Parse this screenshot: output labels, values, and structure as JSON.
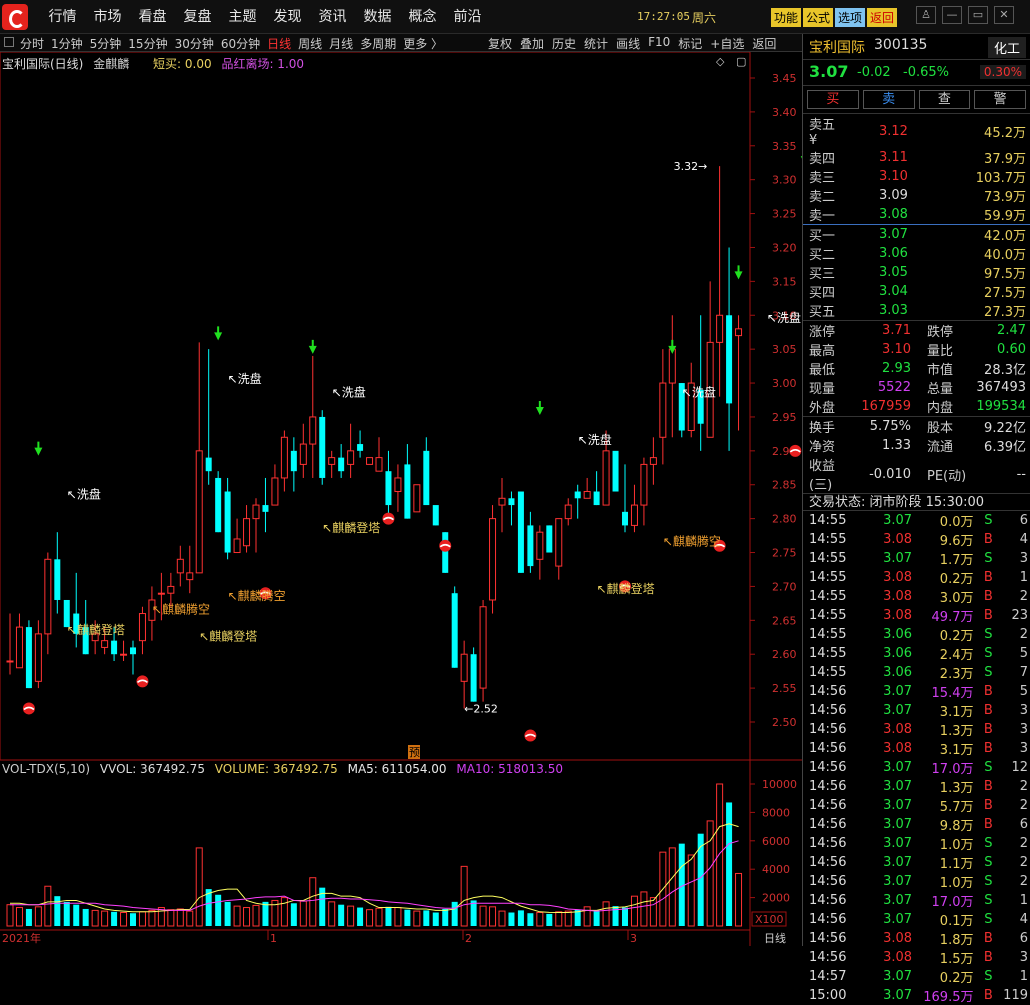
{
  "menu": [
    "行情",
    "市场",
    "看盘",
    "复盘",
    "主题",
    "发现",
    "资讯",
    "数据",
    "概念",
    "前沿"
  ],
  "clock": "17:27:05",
  "weekday": "周六",
  "func_buttons": [
    "功能",
    "公式",
    "选项",
    "返回"
  ],
  "window_buttons": [
    "shirt-icon",
    "minimize-icon",
    "restore-icon",
    "close-icon"
  ],
  "periods": [
    "分时",
    "1分钟",
    "5分钟",
    "15分钟",
    "30分钟",
    "60分钟",
    "日线",
    "周线",
    "月线",
    "多周期",
    "更多 〉"
  ],
  "active_period": "日线",
  "tools": [
    "复权",
    "叠加",
    "历史",
    "统计",
    "画线",
    "F10",
    "标记",
    "+自选",
    "返回"
  ],
  "chart_header": {
    "stock": "宝利国际(日线)",
    "indicator": "金麒麟",
    "short_buy": "短买: 0.00",
    "exit": "品红离场: 1.00"
  },
  "volume_header": {
    "name": "VOL-TDX(5,10)",
    "vvol": "VVOL: 367492.75",
    "volume": "VOLUME: 367492.75",
    "ma5": "MA5: 611054.00",
    "ma10": "MA10: 518013.50"
  },
  "chart_data": {
    "type": "candlestick",
    "price_ticks": [
      3.45,
      3.4,
      3.35,
      3.3,
      3.25,
      3.2,
      3.15,
      3.1,
      3.05,
      3.0,
      2.95,
      2.9,
      2.85,
      2.8,
      2.75,
      2.7,
      2.65,
      2.6,
      2.55,
      2.5
    ],
    "vol_ticks": [
      10000,
      8000,
      6000,
      4000,
      2000
    ],
    "vol_unit": "X100",
    "x_labels": [
      "2021年",
      "1",
      "2",
      "3",
      "日线"
    ],
    "candles": [
      [
        2.59,
        2.66,
        2.57,
        2.59
      ],
      [
        2.58,
        2.66,
        2.58,
        2.64
      ],
      [
        2.64,
        2.65,
        2.55,
        2.55
      ],
      [
        2.56,
        2.65,
        2.55,
        2.63
      ],
      [
        2.63,
        2.75,
        2.6,
        2.74
      ],
      [
        2.74,
        2.78,
        2.66,
        2.68
      ],
      [
        2.68,
        2.68,
        2.64,
        2.64
      ],
      [
        2.66,
        2.72,
        2.61,
        2.63
      ],
      [
        2.64,
        2.68,
        2.6,
        2.6
      ],
      [
        2.62,
        2.65,
        2.6,
        2.63
      ],
      [
        2.61,
        2.64,
        2.6,
        2.62
      ],
      [
        2.62,
        2.64,
        2.59,
        2.6
      ],
      [
        2.6,
        2.62,
        2.59,
        2.6
      ],
      [
        2.61,
        2.62,
        2.57,
        2.6
      ],
      [
        2.62,
        2.67,
        2.6,
        2.66
      ],
      [
        2.65,
        2.7,
        2.62,
        2.68
      ],
      [
        2.69,
        2.72,
        2.65,
        2.69
      ],
      [
        2.69,
        2.72,
        2.67,
        2.7
      ],
      [
        2.72,
        2.76,
        2.7,
        2.74
      ],
      [
        2.71,
        2.76,
        2.69,
        2.72
      ],
      [
        2.72,
        3.06,
        2.73,
        2.9
      ],
      [
        2.89,
        3.05,
        2.85,
        2.87
      ],
      [
        2.86,
        2.87,
        2.78,
        2.78
      ],
      [
        2.84,
        2.86,
        2.74,
        2.75
      ],
      [
        2.75,
        2.8,
        2.75,
        2.77
      ],
      [
        2.76,
        2.82,
        2.75,
        2.8
      ],
      [
        2.8,
        2.83,
        2.75,
        2.82
      ],
      [
        2.82,
        2.86,
        2.78,
        2.81
      ],
      [
        2.82,
        2.88,
        2.82,
        2.86
      ],
      [
        2.86,
        2.93,
        2.84,
        2.92
      ],
      [
        2.9,
        2.92,
        2.84,
        2.87
      ],
      [
        2.88,
        2.94,
        2.86,
        2.91
      ],
      [
        2.91,
        3.04,
        2.86,
        2.95
      ],
      [
        2.95,
        2.96,
        2.85,
        2.86
      ],
      [
        2.88,
        2.9,
        2.86,
        2.89
      ],
      [
        2.89,
        2.91,
        2.86,
        2.87
      ],
      [
        2.88,
        2.94,
        2.86,
        2.9
      ],
      [
        2.91,
        2.93,
        2.89,
        2.9
      ],
      [
        2.88,
        2.89,
        2.88,
        2.89
      ],
      [
        2.87,
        2.92,
        2.88,
        2.89
      ],
      [
        2.87,
        2.9,
        2.8,
        2.82
      ],
      [
        2.84,
        2.88,
        2.81,
        2.86
      ],
      [
        2.88,
        2.91,
        2.8,
        2.8
      ],
      [
        2.81,
        2.85,
        2.81,
        2.85
      ],
      [
        2.9,
        2.92,
        2.86,
        2.82
      ],
      [
        2.82,
        2.8,
        2.79,
        2.79
      ],
      [
        2.78,
        2.78,
        2.72,
        2.72
      ],
      [
        2.69,
        2.7,
        2.58,
        2.58
      ],
      [
        2.56,
        2.62,
        2.52,
        2.6
      ],
      [
        2.6,
        2.61,
        2.53,
        2.53
      ],
      [
        2.55,
        2.68,
        2.53,
        2.67
      ],
      [
        2.68,
        2.82,
        2.66,
        2.8
      ],
      [
        2.82,
        2.86,
        2.78,
        2.83
      ],
      [
        2.83,
        2.84,
        2.79,
        2.82
      ],
      [
        2.84,
        2.83,
        2.72,
        2.72
      ],
      [
        2.79,
        2.81,
        2.72,
        2.73
      ],
      [
        2.74,
        2.79,
        2.71,
        2.78
      ],
      [
        2.79,
        2.79,
        2.76,
        2.75
      ],
      [
        2.73,
        2.8,
        2.71,
        2.8
      ],
      [
        2.8,
        2.83,
        2.79,
        2.82
      ],
      [
        2.84,
        2.85,
        2.8,
        2.83
      ],
      [
        2.83,
        2.86,
        2.83,
        2.84
      ],
      [
        2.84,
        2.87,
        2.82,
        2.82
      ],
      [
        2.82,
        2.93,
        2.82,
        2.9
      ],
      [
        2.9,
        2.85,
        2.85,
        2.84
      ],
      [
        2.81,
        2.88,
        2.78,
        2.79
      ],
      [
        2.79,
        2.85,
        2.78,
        2.82
      ],
      [
        2.82,
        2.89,
        2.79,
        2.88
      ],
      [
        2.88,
        2.92,
        2.85,
        2.89
      ],
      [
        2.92,
        3.05,
        2.88,
        3.0
      ],
      [
        3.0,
        3.1,
        2.92,
        3.05
      ],
      [
        3.0,
        3.0,
        2.92,
        2.93
      ],
      [
        2.93,
        3.03,
        2.92,
        3.0
      ],
      [
        2.99,
        3.1,
        2.9,
        2.94
      ],
      [
        2.92,
        3.15,
        2.92,
        3.06
      ],
      [
        3.06,
        3.32,
        2.98,
        3.1
      ],
      [
        3.1,
        3.2,
        2.9,
        2.97
      ],
      [
        3.07,
        3.1,
        2.93,
        3.08
      ]
    ],
    "volumes": [
      1500,
      1300,
      1200,
      1350,
      2800,
      2100,
      1700,
      1500,
      1200,
      1100,
      1050,
      1000,
      950,
      900,
      1000,
      1100,
      1300,
      1150,
      1200,
      1050,
      5500,
      2600,
      2200,
      1700,
      1400,
      1300,
      1450,
      1700,
      1800,
      2000,
      1600,
      1750,
      3400,
      2700,
      1700,
      1500,
      1400,
      1300,
      1150,
      1250,
      1350,
      1300,
      1150,
      1050,
      1100,
      950,
      1200,
      1700,
      4200,
      1800,
      1400,
      1350,
      1050,
      950,
      1100,
      900,
      950,
      850,
      1000,
      1050,
      1150,
      1350,
      1050,
      1700,
      1400,
      1300,
      2100,
      2400,
      2000,
      5200,
      5500,
      5800,
      5000,
      6500,
      7400,
      10000,
      8700,
      3700
    ],
    "ma5": [
      1.6,
      1.6,
      1.5,
      1.5,
      1.7,
      1.7,
      1.8,
      1.8,
      1.6,
      1.4,
      1.2,
      1.1,
      1.05,
      1.0,
      1.0,
      1.0,
      1.06,
      1.1,
      1.15,
      1.17,
      2.0,
      2.3,
      2.5,
      2.6,
      2.6,
      1.8,
      1.6,
      1.5,
      1.5,
      1.6,
      1.8,
      1.8,
      2.1,
      2.3,
      2.3,
      2.1,
      2.1,
      2.0,
      1.6,
      1.3,
      1.3,
      1.3,
      1.25,
      1.2,
      1.2,
      1.1,
      1.1,
      1.2,
      1.8,
      2.0,
      2.1,
      2.1,
      2.0,
      1.7,
      1.4,
      1.2,
      1.0,
      0.96,
      0.95,
      0.95,
      1.0,
      1.1,
      1.1,
      1.25,
      1.3,
      1.35,
      1.5,
      1.7,
      1.8,
      2.6,
      3.4,
      4.2,
      4.7,
      5.6,
      6.0,
      7.0,
      7.2,
      7.0
    ],
    "ma10": [
      1.5,
      1.5,
      1.5,
      1.5,
      1.55,
      1.6,
      1.6,
      1.6,
      1.6,
      1.6,
      1.5,
      1.45,
      1.4,
      1.3,
      1.25,
      1.2,
      1.15,
      1.1,
      1.1,
      1.1,
      1.4,
      1.6,
      1.7,
      1.8,
      1.85,
      1.9,
      2.0,
      2.05,
      2.05,
      2.1,
      1.8,
      1.75,
      1.8,
      1.9,
      1.95,
      1.95,
      1.9,
      1.9,
      1.85,
      1.8,
      1.7,
      1.65,
      1.6,
      1.5,
      1.4,
      1.3,
      1.25,
      1.25,
      1.5,
      1.6,
      1.6,
      1.6,
      1.6,
      1.6,
      1.6,
      1.5,
      1.5,
      1.45,
      1.35,
      1.2,
      1.15,
      1.1,
      1.05,
      1.1,
      1.15,
      1.2,
      1.3,
      1.4,
      1.5,
      1.9,
      2.4,
      2.8,
      3.1,
      3.4,
      4.1,
      5.1,
      5.8,
      6.0
    ],
    "buy_markers": [
      [
        3,
        2.89
      ],
      [
        22,
        3.06
      ],
      [
        32,
        3.04
      ],
      [
        56,
        2.95
      ],
      [
        70,
        3.04
      ],
      [
        77,
        3.15
      ],
      [
        84,
        3.32
      ]
    ],
    "annotations": [
      {
        "text": "洗盘",
        "x": 6,
        "y": 2.83,
        "color": "#ffffff"
      },
      {
        "text": "洗盘",
        "x": 23,
        "y": 3.0,
        "color": "#ffffff"
      },
      {
        "text": "洗盘",
        "x": 34,
        "y": 2.98,
        "color": "#ffffff"
      },
      {
        "text": "洗盘",
        "x": 60,
        "y": 2.91,
        "color": "#ffffff"
      },
      {
        "text": "洗盘",
        "x": 71,
        "y": 2.98,
        "color": "#ffffff"
      },
      {
        "text": "洗盘",
        "x": 80,
        "y": 3.09,
        "color": "#ffffff"
      },
      {
        "text": "洗盘",
        "x": 86,
        "y": 3.24,
        "color": "#ffffff"
      },
      {
        "text": "麒麟登塔",
        "x": 6,
        "y": 2.63,
        "color": "#e8d060"
      },
      {
        "text": "麒麟腾空",
        "x": 15,
        "y": 2.66,
        "color": "#f0a030"
      },
      {
        "text": "麒麟登塔",
        "x": 20,
        "y": 2.62,
        "color": "#e8d060"
      },
      {
        "text": "麒麟腾空",
        "x": 23,
        "y": 2.68,
        "color": "#f0a030"
      },
      {
        "text": "麒麟登塔",
        "x": 33,
        "y": 2.78,
        "color": "#e8d060"
      },
      {
        "text": "麒麟登塔",
        "x": 62,
        "y": 2.69,
        "color": "#e8d060"
      },
      {
        "text": "麒麟腾空",
        "x": 69,
        "y": 2.76,
        "color": "#f0a030"
      }
    ],
    "red_balls": [
      [
        2,
        2.52
      ],
      [
        14,
        2.56
      ],
      [
        27,
        2.69
      ],
      [
        40,
        2.8
      ],
      [
        46,
        2.76
      ],
      [
        55,
        2.48
      ],
      [
        65,
        2.7
      ],
      [
        75,
        2.76
      ],
      [
        83,
        2.9
      ]
    ],
    "high_label": "3.32",
    "low_label": "2.52",
    "yu_label": "预"
  },
  "quote": {
    "name": "宝利国际",
    "code": "300135",
    "industry": "化工",
    "price": "3.07",
    "change": "-0.02",
    "pct": "-0.65%",
    "box": "0.30%",
    "buttons": [
      "买",
      "卖",
      "查",
      "警"
    ]
  },
  "orderbook": [
    {
      "label": "卖五 ¥",
      "price": "3.12",
      "vol": "45.2万",
      "color": "red"
    },
    {
      "label": "卖四",
      "price": "3.11",
      "vol": "37.9万",
      "color": "red"
    },
    {
      "label": "卖三",
      "price": "3.10",
      "vol": "103.7万",
      "color": "red"
    },
    {
      "label": "卖二",
      "price": "3.09",
      "vol": "73.9万",
      "color": "wht"
    },
    {
      "label": "卖一",
      "price": "3.08",
      "vol": "59.9万",
      "color": "grn"
    },
    {
      "label": "买一",
      "price": "3.07",
      "vol": "42.0万",
      "color": "grn"
    },
    {
      "label": "买二",
      "price": "3.06",
      "vol": "40.0万",
      "color": "grn"
    },
    {
      "label": "买三",
      "price": "3.05",
      "vol": "97.5万",
      "color": "grn"
    },
    {
      "label": "买四",
      "price": "3.04",
      "vol": "27.5万",
      "color": "grn"
    },
    {
      "label": "买五",
      "price": "3.03",
      "vol": "27.3万",
      "color": "grn"
    }
  ],
  "stats": [
    {
      "k1": "涨停",
      "v1": "3.71",
      "c1": "red",
      "k2": "跌停",
      "v2": "2.47",
      "c2": "grn"
    },
    {
      "k1": "最高",
      "v1": "3.10",
      "c1": "red",
      "k2": "量比",
      "v2": "0.60",
      "c2": "grn"
    },
    {
      "k1": "最低",
      "v1": "2.93",
      "c1": "grn",
      "k2": "市值",
      "v2": "28.3亿",
      "c2": "wht"
    },
    {
      "k1": "现量",
      "v1": "5522",
      "c1": "mag",
      "k2": "总量",
      "v2": "367493",
      "c2": "wht"
    },
    {
      "k1": "外盘",
      "v1": "167959",
      "c1": "red",
      "k2": "内盘",
      "v2": "199534",
      "c2": "grn"
    },
    {
      "k1": "换手",
      "v1": "5.75%",
      "c1": "wht",
      "k2": "股本",
      "v2": "9.22亿",
      "c2": "wht"
    },
    {
      "k1": "净资",
      "v1": "1.33",
      "c1": "wht",
      "k2": "流通",
      "v2": "6.39亿",
      "c2": "wht"
    },
    {
      "k1": "收益(三)",
      "v1": "-0.010",
      "c1": "wht",
      "k2": "PE(动)",
      "v2": "--",
      "c2": "wht"
    }
  ],
  "trade_status": "交易状态: 闭市阶段 15:30:00",
  "ticks": [
    [
      "14:55",
      "3.07",
      "0.0万",
      "S",
      "6"
    ],
    [
      "14:55",
      "3.08",
      "9.6万",
      "B",
      "4"
    ],
    [
      "14:55",
      "3.07",
      "1.7万",
      "S",
      "3"
    ],
    [
      "14:55",
      "3.08",
      "0.2万",
      "B",
      "1"
    ],
    [
      "14:55",
      "3.08",
      "3.0万",
      "B",
      "2"
    ],
    [
      "14:55",
      "3.08",
      "49.7万",
      "B",
      "23"
    ],
    [
      "14:55",
      "3.06",
      "0.2万",
      "S",
      "2"
    ],
    [
      "14:55",
      "3.06",
      "2.4万",
      "S",
      "5"
    ],
    [
      "14:55",
      "3.06",
      "2.3万",
      "S",
      "7"
    ],
    [
      "14:56",
      "3.07",
      "15.4万",
      "B",
      "5"
    ],
    [
      "14:56",
      "3.07",
      "3.1万",
      "B",
      "3"
    ],
    [
      "14:56",
      "3.08",
      "1.3万",
      "B",
      "3"
    ],
    [
      "14:56",
      "3.08",
      "3.1万",
      "B",
      "3"
    ],
    [
      "14:56",
      "3.07",
      "17.0万",
      "S",
      "12"
    ],
    [
      "14:56",
      "3.07",
      "1.3万",
      "B",
      "2"
    ],
    [
      "14:56",
      "3.07",
      "5.7万",
      "B",
      "2"
    ],
    [
      "14:56",
      "3.07",
      "9.8万",
      "B",
      "6"
    ],
    [
      "14:56",
      "3.07",
      "1.0万",
      "S",
      "2"
    ],
    [
      "14:56",
      "3.07",
      "1.1万",
      "S",
      "2"
    ],
    [
      "14:56",
      "3.07",
      "1.0万",
      "S",
      "2"
    ],
    [
      "14:56",
      "3.07",
      "17.0万",
      "S",
      "1"
    ],
    [
      "14:56",
      "3.07",
      "0.1万",
      "S",
      "4"
    ],
    [
      "14:56",
      "3.08",
      "1.8万",
      "B",
      "6"
    ],
    [
      "14:56",
      "3.08",
      "1.5万",
      "B",
      "3"
    ],
    [
      "14:57",
      "3.07",
      "0.2万",
      "S",
      "1"
    ],
    [
      "15:00",
      "3.07",
      "169.5万",
      "B",
      "119"
    ]
  ]
}
